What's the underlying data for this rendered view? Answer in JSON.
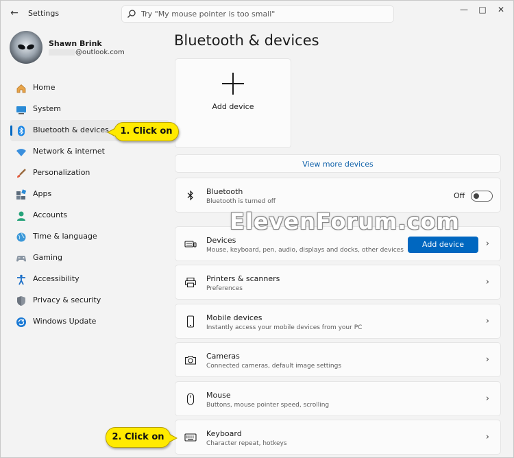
{
  "window": {
    "title": "Settings",
    "back_icon": "back-arrow-icon",
    "controls": [
      "minimize-icon",
      "maximize-icon",
      "close-icon"
    ]
  },
  "search": {
    "placeholder": "Try \"My mouse pointer is too small\"",
    "icon": "search-icon"
  },
  "profile": {
    "name": "Shawn Brink",
    "email": "@outlook.com"
  },
  "sidebar": {
    "items": [
      {
        "label": "Home",
        "icon": "home-icon",
        "active": false
      },
      {
        "label": "System",
        "icon": "system-icon",
        "active": false
      },
      {
        "label": "Bluetooth & devices",
        "icon": "bluetooth-icon",
        "active": true
      },
      {
        "label": "Network & internet",
        "icon": "wifi-icon",
        "active": false
      },
      {
        "label": "Personalization",
        "icon": "brush-icon",
        "active": false
      },
      {
        "label": "Apps",
        "icon": "apps-icon",
        "active": false
      },
      {
        "label": "Accounts",
        "icon": "person-icon",
        "active": false
      },
      {
        "label": "Time & language",
        "icon": "globe-icon",
        "active": false
      },
      {
        "label": "Gaming",
        "icon": "gamepad-icon",
        "active": false
      },
      {
        "label": "Accessibility",
        "icon": "accessibility-icon",
        "active": false
      },
      {
        "label": "Privacy & security",
        "icon": "shield-icon",
        "active": false
      },
      {
        "label": "Windows Update",
        "icon": "update-icon",
        "active": false
      }
    ]
  },
  "main": {
    "title": "Bluetooth & devices",
    "add_tile_label": "Add device",
    "view_more": "View more devices",
    "bluetooth": {
      "title": "Bluetooth",
      "subtitle": "Bluetooth is turned off",
      "toggle_label": "Off",
      "toggle_on": false
    },
    "cards": [
      {
        "title": "Devices",
        "subtitle": "Mouse, keyboard, pen, audio, displays and docks, other devices",
        "icon": "devices-icon",
        "button": "Add device"
      },
      {
        "title": "Printers & scanners",
        "subtitle": "Preferences",
        "icon": "printer-icon"
      },
      {
        "title": "Mobile devices",
        "subtitle": "Instantly access your mobile devices from your PC",
        "icon": "phone-icon"
      },
      {
        "title": "Cameras",
        "subtitle": "Connected cameras, default image settings",
        "icon": "camera-icon"
      },
      {
        "title": "Mouse",
        "subtitle": "Buttons, mouse pointer speed, scrolling",
        "icon": "mouse-icon"
      },
      {
        "title": "Keyboard",
        "subtitle": "Character repeat, hotkeys",
        "icon": "keyboard-icon"
      }
    ]
  },
  "watermark": "ElevenForum.com",
  "callouts": {
    "step1": "1. Click on",
    "step2": "2. Click on"
  },
  "colors": {
    "accent": "#0067c0",
    "callout": "#ffea00",
    "background": "#f3f3f3"
  }
}
